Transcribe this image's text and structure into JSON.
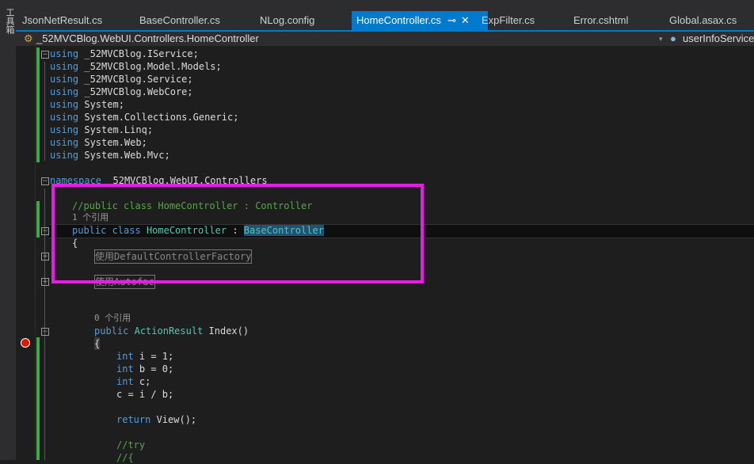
{
  "sidebar": {
    "toolbox_label": "工具箱"
  },
  "tabs": [
    {
      "label": "JsonNetResult.cs"
    },
    {
      "label": "BaseController.cs"
    },
    {
      "label": "NLog.config"
    },
    {
      "label": "HomeController.cs",
      "active": true
    },
    {
      "label": "ExpFilter.cs"
    },
    {
      "label": "Error.cshtml"
    },
    {
      "label": "Global.asax.cs"
    }
  ],
  "navbar": {
    "class_path": "_52MVCBlog.WebUI.Controllers.HomeController",
    "member": "userInfoService"
  },
  "code": {
    "usings": [
      "_52MVCBlog.IService;",
      "_52MVCBlog.Model.Models;",
      "_52MVCBlog.Service;",
      "_52MVCBlog.WebCore;",
      "System;",
      "System.Collections.Generic;",
      "System.Linq;",
      "System.Web;",
      "System.Web.Mvc;"
    ],
    "using_kw": "using",
    "namespace_kw": "namespace",
    "namespace_name": "_52MVCBlog.WebUI.Controllers",
    "comment_class": "//public class HomeController : Controller",
    "lens_class": "1 个引用",
    "kw_public_class": "public class",
    "class_name": "HomeController",
    "colon": " : ",
    "base_class": "BaseController",
    "open_brace": "{",
    "region1": "使用DefaultControllerFactory",
    "region2": "使用Autofac",
    "lens_index": "0 个引用",
    "kw_public": "public",
    "action_type": "ActionResult",
    "method_sig": " Index()",
    "body": [
      "int i = 1;",
      "int b = 0;",
      "int c;",
      "c = i / b;"
    ],
    "return_line": "return View();",
    "try_comment": "//try",
    "brace_comment": "//{"
  },
  "colors": {
    "highlight_box": "#e81ce8",
    "accent": "#007acc",
    "breakpoint": "#e51400"
  }
}
